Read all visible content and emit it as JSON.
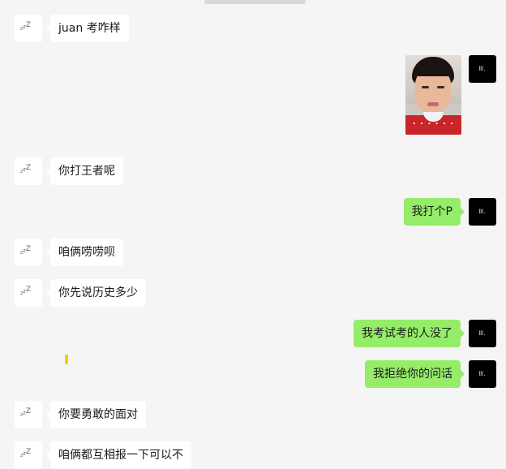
{
  "messages": [
    {
      "side": "left",
      "type": "text",
      "text": "juan 考咋样"
    },
    {
      "side": "right",
      "type": "sticker",
      "caption": ". . .  . . ."
    },
    {
      "side": "left",
      "type": "text",
      "text": "你打王者呢"
    },
    {
      "side": "right",
      "type": "text",
      "text": "我打个P"
    },
    {
      "side": "left",
      "type": "text",
      "text": "咱俩唠唠呗"
    },
    {
      "side": "left",
      "type": "text",
      "text": "你先说历史多少"
    },
    {
      "side": "right",
      "type": "text",
      "text": "我考试考的人没了"
    },
    {
      "side": "right",
      "type": "text",
      "text": "我拒绝你的问话"
    },
    {
      "side": "left",
      "type": "text",
      "text": "你要勇敢的面对"
    },
    {
      "side": "left",
      "type": "text",
      "text": "咱俩都互相报一下可以不"
    }
  ],
  "avatars": {
    "friend": {
      "icon": "sleeping-zzz-icon",
      "text": "zzZ"
    },
    "me": {
      "icon": "small-white-mark-icon",
      "text": "ꟾꟾꟾ."
    }
  },
  "colors": {
    "background": "#f5f5f5",
    "friend_bubble": "#ffffff",
    "my_bubble": "#95ec69",
    "my_avatar": "#000000"
  }
}
